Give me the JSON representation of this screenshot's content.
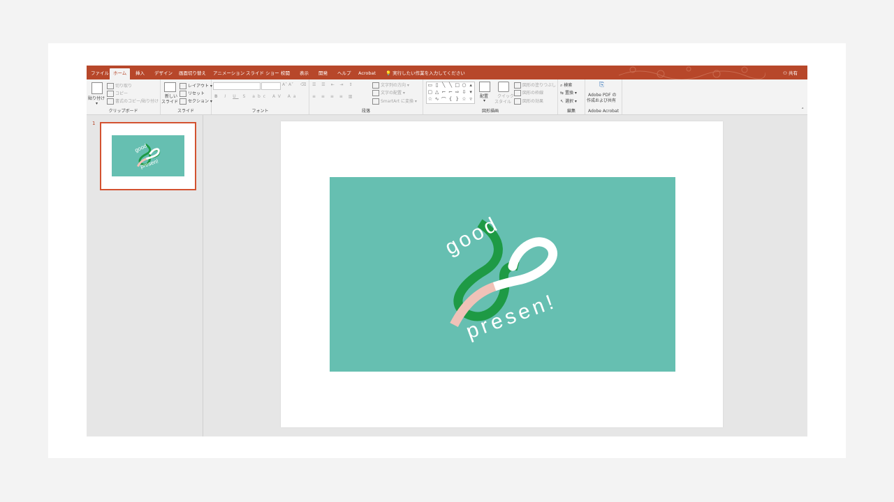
{
  "tabs": [
    {
      "label": "ファイル"
    },
    {
      "label": "ホーム"
    },
    {
      "label": "挿入"
    },
    {
      "label": "デザイン"
    },
    {
      "label": "画面切り替え"
    },
    {
      "label": "アニメーション"
    },
    {
      "label": "スライド ショー"
    },
    {
      "label": "校閲"
    },
    {
      "label": "表示"
    },
    {
      "label": "開発"
    },
    {
      "label": "ヘルプ"
    },
    {
      "label": "Acrobat"
    }
  ],
  "active_tab": "ホーム",
  "tell_me": "実行したい作業を入力してください",
  "share": "共有",
  "ribbon": {
    "clipboard": {
      "label": "クリップボード",
      "paste": "貼り付け",
      "cut": "切り取り",
      "copy": "コピー",
      "format_painter": "書式のコピー/貼り付け"
    },
    "slides": {
      "label": "スライド",
      "new_slide_1": "新しい",
      "new_slide_2": "スライド",
      "layout": "レイアウト",
      "reset": "リセット",
      "section": "セクション"
    },
    "font": {
      "label": "フォント",
      "buttons": [
        "B",
        "I",
        "U",
        "S",
        "abc",
        "AV",
        "Aa"
      ]
    },
    "paragraph": {
      "label": "段落",
      "text_direction": "文字列の方向",
      "align_text": "文字の配置",
      "smartart": "SmartArt に変換"
    },
    "drawing": {
      "label": "図形描画",
      "arrange": "配置",
      "quick_styles_1": "クイック",
      "quick_styles_2": "スタイル",
      "shape_fill": "図形の塗りつぶし",
      "shape_outline": "図形の枠線",
      "shape_effects": "図形の効果"
    },
    "editing": {
      "label": "編集",
      "find": "検索",
      "replace": "置換",
      "select": "選択"
    },
    "acrobat": {
      "label": "Adobe Acrobat",
      "create_1": "Adobe PDF の",
      "create_2": "作成および共有"
    }
  },
  "thumbnail": {
    "number": "1"
  },
  "slide": {
    "logo_word1": "good",
    "logo_word2": "presen!",
    "colors": {
      "teal": "#66bfb1",
      "green": "#1e9a45",
      "pink": "#f0c2b8",
      "white": "#ffffff"
    }
  }
}
